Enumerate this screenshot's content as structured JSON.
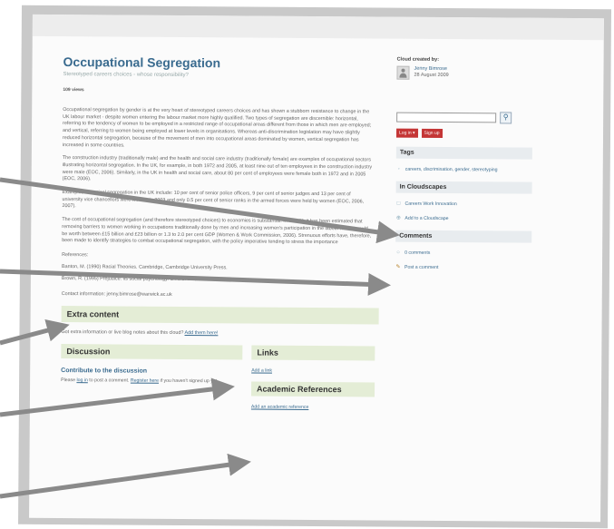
{
  "page": {
    "title": "Occupational Segregation",
    "subtitle": "Stereotyped careers choices - whose responsibility?",
    "views": "109 views",
    "paragraphs": [
      "Occupational segregation by gender is at the very heart of stereotyped careers choices and has shown a stubborn resistance to change in the UK labour market - despite women entering the labour market more highly qualified. Two types of segregation are discernible: horizontal, referring to the tendency of women to be employed in a restricted range of occupational areas different from those in which men are employed; and vertical, referring to women being employed at lower levels in organisations. Whereas anti-discrimination legislation may have slightly reduced horizontal segregation, because of the movement of men into occupational areas dominated by women, vertical segregation has increased in some countries.",
      "The construction industry (traditionally male) and the health and social care industry (traditionally female) are examples of occupational sectors illustrating horizontal segregation. In the UK, for example, in both 1972 and 2005, at least nine out of ten employees in the construction industry were male (EOC, 2006). Similarly, in the UK in health and social care, about 80 per cent of employees were female both in 1972 and in 2005 (EOC, 2006).",
      "Examples of vertical segregation in the UK include: 10 per cent of senior police officers, 9 per cent of senior judges and 13 per cent of university vice chancellors were women in 2003 and only 0.5 per cent of senior ranks in the armed forces were held by women (EOC, 2006, 2007).",
      "The cost of occupational segregation (and therefore stereotyped choices) to economies is substantial. In the UK, it has been estimated that removing barriers to women working in occupations traditionally done by men and increasing women's participation in the labour market could be worth between £15 billion and £23 billion or 1.3 to 2.0 per cent GDP (Women & Work Commission, 2006). Strenuous efforts have, therefore, been made to identify strategies to combat occupational segregation, with the policy imperative tending to stress the importance"
    ],
    "references_label": "References:",
    "references": [
      "Banton, M. (1990) Racial Theories. Cambridge, Cambridge University Press.",
      "Brown, R. (1995) Prejudice: its social psychology. Oxford: Blackwell."
    ],
    "contact": "Contact information: jenny.bimrose@warwick.ac.uk"
  },
  "extra": {
    "heading": "Extra content",
    "text": "Got extra information or live blog notes about this cloud?",
    "link": "Add them here!"
  },
  "discussion": {
    "heading": "Discussion",
    "contribute": "Contribute to the discussion",
    "please": "Please",
    "login": "log in",
    "mid": "to post a comment.",
    "register": "Register here",
    "tail": "if you haven't signed up yet."
  },
  "links": {
    "heading": "Links",
    "add": "Add a link"
  },
  "academic": {
    "heading": "Academic References",
    "add": "Add an academic reference"
  },
  "sidebar": {
    "created_by": "Cloud created by:",
    "author": "Jenny Bimrose",
    "date": "28 August 2009",
    "search_placeholder": "",
    "login_btn": "Log in ▾",
    "signup_btn": "Sign up",
    "tags_heading": "Tags",
    "tags": "careers, discrimination, gender, stereotyping",
    "cloudscapes_heading": "In Cloudscapes",
    "cloudscape": "Careers Work Innovation",
    "add_cloudscape": "Add to a Cloudscape",
    "comments_heading": "Comments",
    "comments_count": "0 comments",
    "post_comment": "Post a comment"
  },
  "colors": {
    "accent": "#3a6b8f",
    "section_green": "#e4edd6",
    "button_red": "#c43535",
    "arrow": "#8a8a8a"
  }
}
